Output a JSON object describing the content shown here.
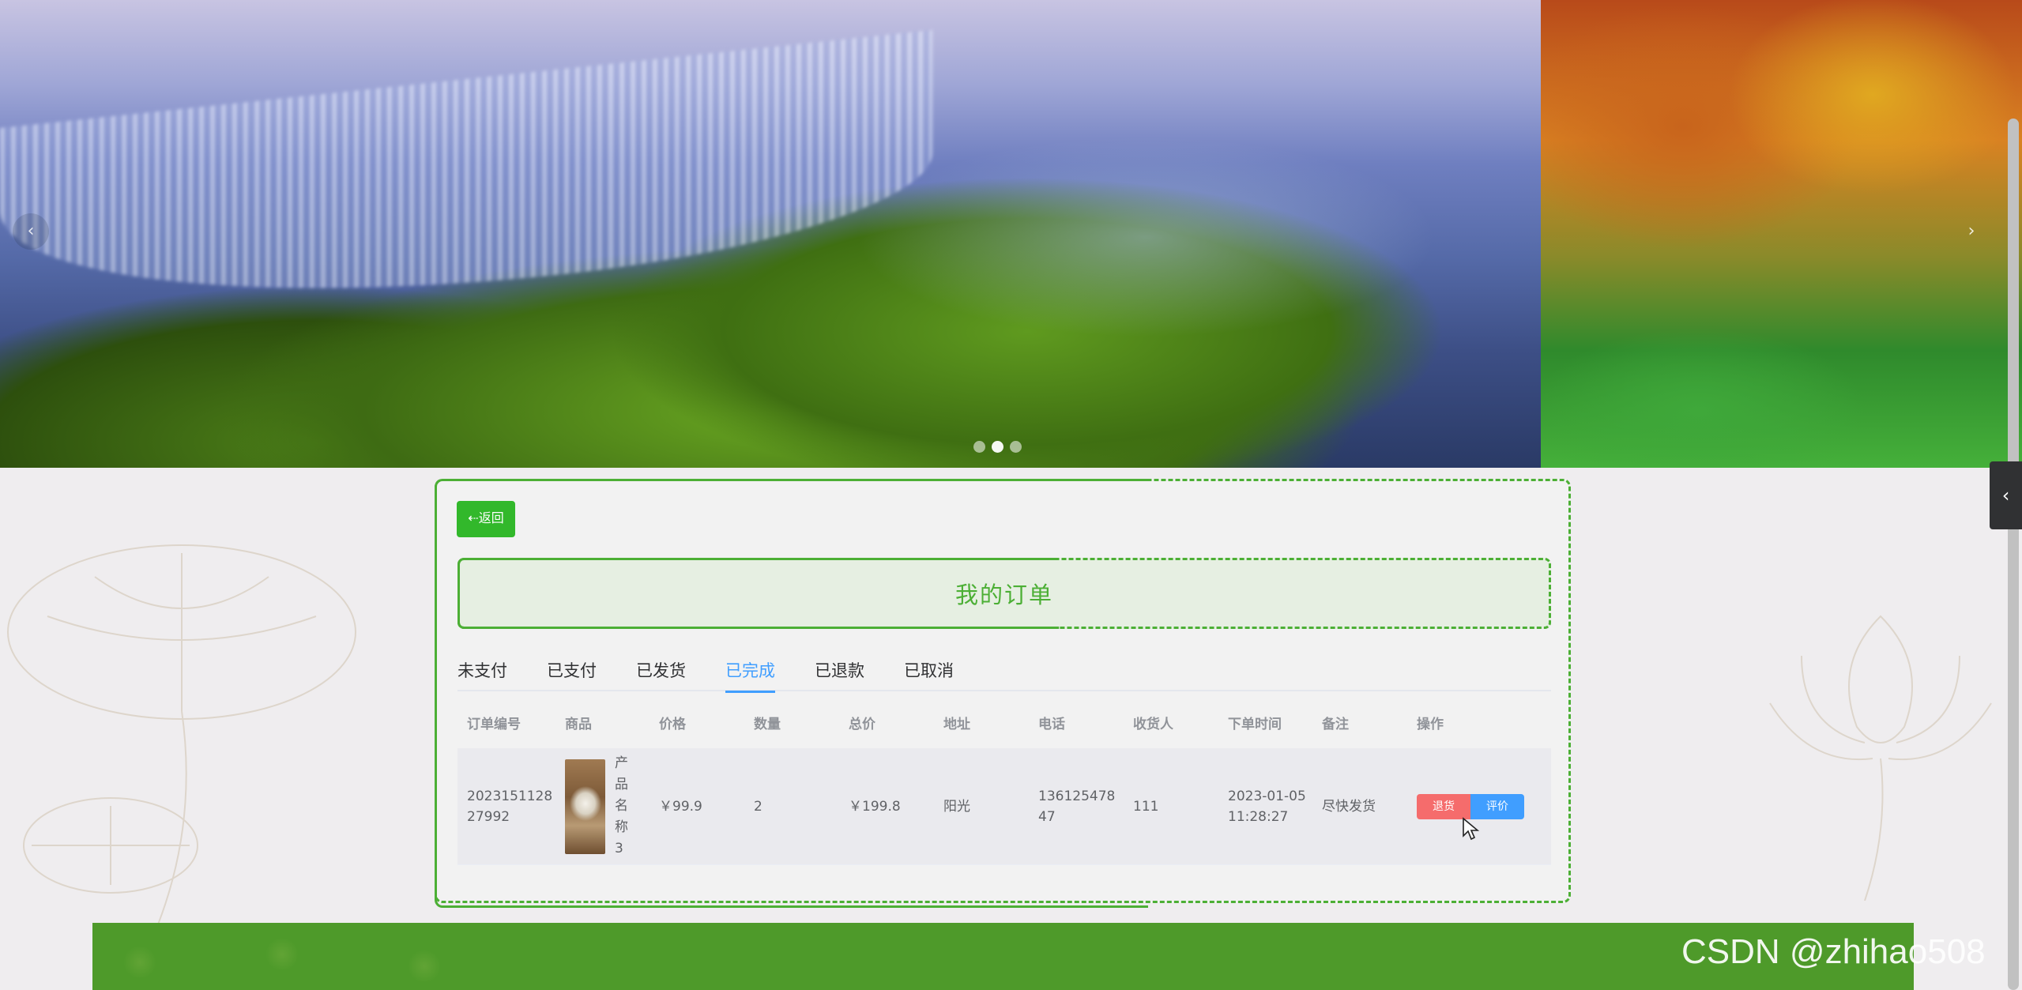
{
  "carousel": {
    "prev_label": "‹",
    "next_label": "›",
    "indicator_count": 3
  },
  "panel": {
    "back_label": "⇠返回",
    "title": "我的订单",
    "tabs": [
      "未支付",
      "已支付",
      "已发货",
      "已完成",
      "已退款",
      "已取消"
    ],
    "active_tab": "已完成"
  },
  "table": {
    "headers": [
      "订单编号",
      "商品",
      "价格",
      "数量",
      "总价",
      "地址",
      "电话",
      "收货人",
      "下单时间",
      "备注",
      "操作"
    ],
    "rows": [
      {
        "order_no": "202315112827992",
        "product": "产品名称3",
        "price": "￥99.9",
        "quantity": "2",
        "total": "￥199.8",
        "address": "阳光",
        "phone": "13612547847",
        "receiver": "111",
        "time": "2023-01-05 11:28:27",
        "note": "尽快发货",
        "actions": {
          "refund": "退货",
          "review": "评价"
        }
      }
    ]
  },
  "side_toggle_label": "‹",
  "watermark": "CSDN @zhihao508",
  "colors": {
    "accent_green": "#4caf35",
    "button_green": "#32b82b",
    "tab_active": "#409eff",
    "danger": "#f56c6c",
    "primary": "#409eff"
  }
}
